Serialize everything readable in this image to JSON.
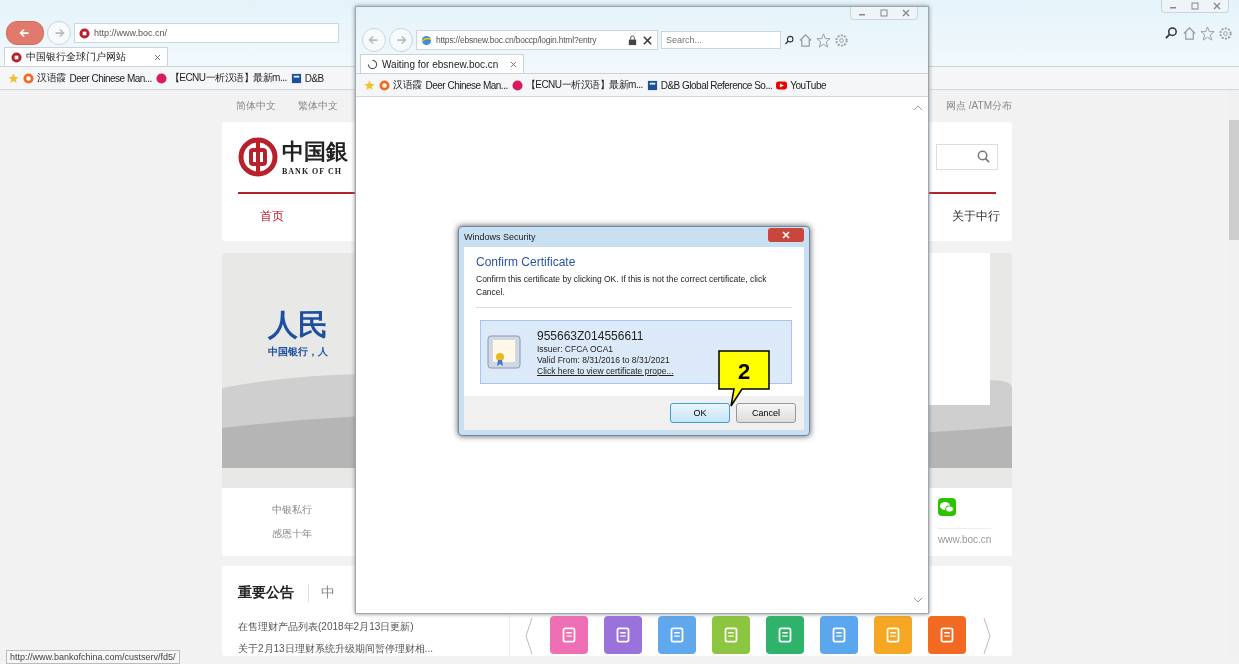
{
  "back_window": {
    "address": "http://www.boc.cn/",
    "tabs": [
      {
        "label": "中国银行全球门户网站",
        "selected": true
      }
    ],
    "favorites": [
      {
        "kind": "orange",
        "label": "汉语霞"
      },
      {
        "kind": "plain",
        "label": "Deer Chinese Man..."
      },
      {
        "kind": "ball",
        "label": "【ECNU一析汉语】最新m..."
      },
      {
        "kind": "db",
        "label": "D&B"
      }
    ],
    "status_url": "http://www.bankofchina.com/custserv/fd5/"
  },
  "page": {
    "language_links": [
      "简体中文",
      "繁体中文"
    ],
    "top_right_link": "网点 /ATM分布",
    "logo": {
      "chinese": "中国銀",
      "english": "BANK OF CH"
    },
    "nav": [
      {
        "label": "首页",
        "selected": true
      },
      {
        "label": "关于中行",
        "selected": false
      }
    ],
    "banner": {
      "title": "人民",
      "subtitle": "中国银行，人"
    },
    "private_banking": [
      "中银私行",
      "感恩十年"
    ],
    "site_url": "www.boc.cn",
    "notices": {
      "title": "重要公告",
      "tab_2": "中",
      "items": [
        "在售理财产品列表(2018年2月13日更新)",
        "关于2月13日理财系统升级期间暂停理财相..."
      ]
    },
    "service_tiles": [
      {
        "color": "#ee6fb4"
      },
      {
        "color": "#9b72dc"
      },
      {
        "color": "#5fa8ee"
      },
      {
        "color": "#8cc53f"
      },
      {
        "color": "#2fb36b"
      },
      {
        "color": "#5aa7f0"
      },
      {
        "color": "#f5a623"
      },
      {
        "color": "#f26a21"
      }
    ]
  },
  "front_window": {
    "address": "https://ebsnew.boc.cn/boccp/login.html?entry",
    "search_placeholder": "Search...",
    "tabs": [
      {
        "label": "Waiting for ebsnew.boc.cn",
        "selected": true
      }
    ],
    "favorites": [
      {
        "kind": "orange",
        "label": "汉语霞"
      },
      {
        "kind": "plain",
        "label": "Deer Chinese Man..."
      },
      {
        "kind": "ball",
        "label": "【ECNU一析汉语】最新m..."
      },
      {
        "kind": "db",
        "label": "D&B Global Reference So..."
      },
      {
        "kind": "youtube",
        "label": "YouTube"
      }
    ]
  },
  "dialog": {
    "title": "Windows Security",
    "heading": "Confirm Certificate",
    "message": "Confirm this certificate by clicking OK. If this is not the correct certificate, click Cancel.",
    "certificate": {
      "name": "955663Z014556611",
      "issuer": "Issuer: CFCA OCA1",
      "valid": "Valid From: 8/31/2016 to 8/31/2021",
      "link": "Click here to view certificate prope..."
    },
    "buttons": [
      {
        "label": "OK",
        "selected": true
      },
      {
        "label": "Cancel",
        "selected": false
      }
    ]
  },
  "callout": "2"
}
